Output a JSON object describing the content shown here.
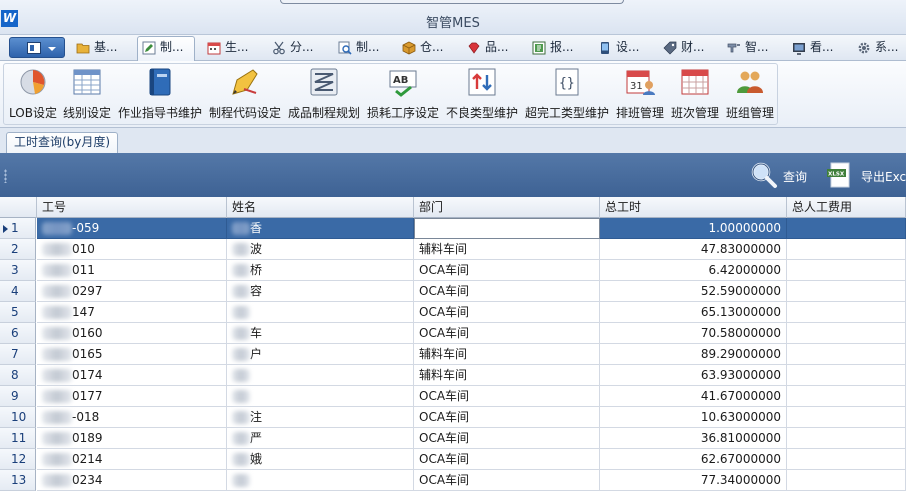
{
  "window": {
    "logo": "W",
    "title": "智管MES"
  },
  "module_tabs": [
    {
      "label": "基...",
      "icon": "folder-icon",
      "active": false
    },
    {
      "label": "制...",
      "icon": "pencil-icon",
      "active": true
    },
    {
      "label": "生...",
      "icon": "calendar-icon",
      "active": false
    },
    {
      "label": "分...",
      "icon": "scissors-icon",
      "active": false
    },
    {
      "label": "制...",
      "icon": "inspect-icon",
      "active": false
    },
    {
      "label": "仓...",
      "icon": "box-icon",
      "active": false
    },
    {
      "label": "品...",
      "icon": "diamond-icon",
      "active": false
    },
    {
      "label": "报...",
      "icon": "report-icon",
      "active": false
    },
    {
      "label": "设...",
      "icon": "device-icon",
      "active": false
    },
    {
      "label": "财...",
      "icon": "tag-icon",
      "active": false
    },
    {
      "label": "智...",
      "icon": "faucet-icon",
      "active": false
    },
    {
      "label": "看...",
      "icon": "monitor-icon",
      "active": false
    },
    {
      "label": "系...",
      "icon": "gear-icon",
      "active": false
    }
  ],
  "ribbon": [
    {
      "label": "LOB设定",
      "icon": "pie-chart-icon"
    },
    {
      "label": "线别设定",
      "icon": "table-grid-icon"
    },
    {
      "label": "作业指导书维护",
      "icon": "book-icon"
    },
    {
      "label": "制程代码设定",
      "icon": "pencil-ruler-icon"
    },
    {
      "label": "成品制程规划",
      "icon": "route-icon"
    },
    {
      "label": "损耗工序设定",
      "icon": "spellcheck-icon"
    },
    {
      "label": "不良类型维护",
      "icon": "sort-arrows-icon"
    },
    {
      "label": "超完工类型维护",
      "icon": "code-braces-icon"
    },
    {
      "label": "排班管理",
      "icon": "calendar-person-icon"
    },
    {
      "label": "班次管理",
      "icon": "calendar-grid-icon"
    },
    {
      "label": "班组管理",
      "icon": "team-icon"
    }
  ],
  "document_tab": "工时查询(by月度)",
  "toolbar": {
    "query_label": "查询",
    "export_label": "导出Exc",
    "export_badge": "XLSX"
  },
  "grid": {
    "columns": [
      "工号",
      "姓名",
      "部门",
      "总工时",
      "总人工费用"
    ],
    "rows": [
      {
        "num": "1",
        "id": "-059",
        "name": "香",
        "dept": "",
        "hours": "1.00000000",
        "selected": true
      },
      {
        "num": "2",
        "id": "010",
        "name": "波",
        "dept": "辅料车间",
        "hours": "47.83000000"
      },
      {
        "num": "3",
        "id": "011",
        "name": "桥",
        "dept": "OCA车间",
        "hours": "6.42000000"
      },
      {
        "num": "4",
        "id": "0297",
        "name": "容",
        "dept": "OCA车间",
        "hours": "52.59000000"
      },
      {
        "num": "5",
        "id": "147",
        "name": "",
        "dept": "OCA车间",
        "hours": "65.13000000"
      },
      {
        "num": "6",
        "id": "0160",
        "name": "车",
        "dept": "OCA车间",
        "hours": "70.58000000"
      },
      {
        "num": "7",
        "id": "0165",
        "name": "户",
        "dept": "辅料车间",
        "hours": "89.29000000"
      },
      {
        "num": "8",
        "id": "0174",
        "name": "",
        "dept": "辅料车间",
        "hours": "63.93000000"
      },
      {
        "num": "9",
        "id": "0177",
        "name": "",
        "dept": "OCA车间",
        "hours": "41.67000000"
      },
      {
        "num": "10",
        "id": "-018",
        "name": "注",
        "dept": "OCA车间",
        "hours": "10.63000000"
      },
      {
        "num": "11",
        "id": "0189",
        "name": "严",
        "dept": "OCA车间",
        "hours": "36.81000000"
      },
      {
        "num": "12",
        "id": "0214",
        "name": "娥",
        "dept": "OCA车间",
        "hours": "62.67000000"
      },
      {
        "num": "13",
        "id": "0234",
        "name": "",
        "dept": "OCA车间",
        "hours": "77.34000000"
      }
    ]
  }
}
